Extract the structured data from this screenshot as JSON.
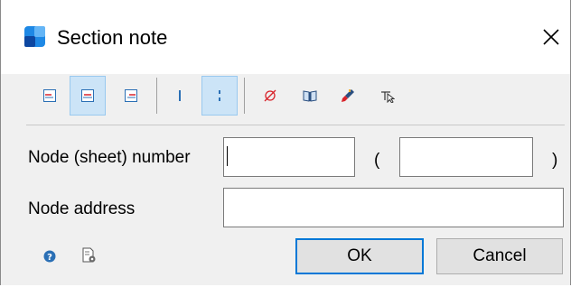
{
  "window": {
    "title": "Section note"
  },
  "toolbar": {
    "buttons": [
      {
        "name": "align-left-icon",
        "active": false
      },
      {
        "name": "align-center-icon",
        "active": true
      },
      {
        "name": "align-right-icon",
        "active": false
      },
      {
        "name": "line-solid-icon",
        "active": false
      },
      {
        "name": "line-dotted-icon",
        "active": true
      },
      {
        "name": "diameter-icon",
        "active": false
      },
      {
        "name": "book-icon",
        "active": false
      },
      {
        "name": "paint-brush-icon",
        "active": false
      },
      {
        "name": "pointer-leader-icon",
        "active": false
      }
    ]
  },
  "form": {
    "node_number_label": "Node (sheet) number",
    "open_paren": "(",
    "close_paren": ")",
    "node_address_label": "Node address",
    "node_number_value": "",
    "sheet_value": "",
    "node_address_value": ""
  },
  "footer": {
    "ok_label": "OK",
    "cancel_label": "Cancel"
  },
  "colors": {
    "accent": "#0078d7",
    "toolbar_active_bg": "#cce4f7",
    "icon_red": "#d8232a",
    "icon_blue": "#2a6fb5"
  }
}
